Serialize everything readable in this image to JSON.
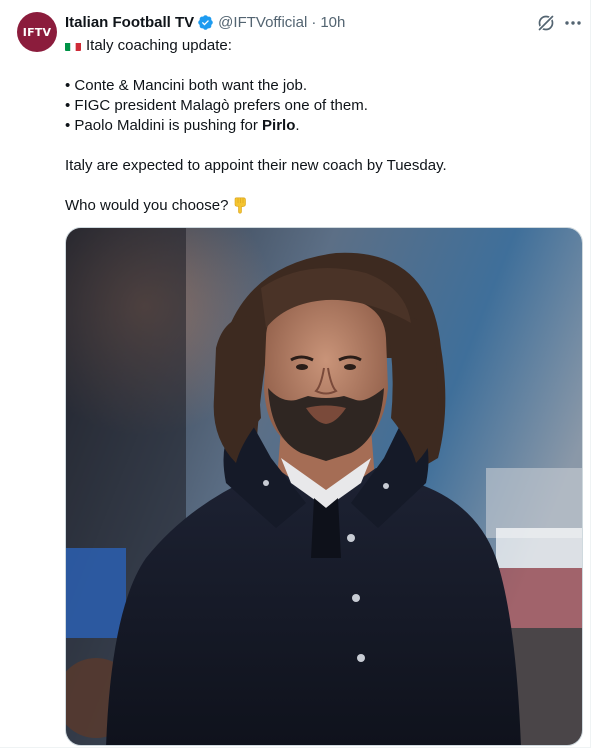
{
  "account": {
    "avatar_text": "IFTV",
    "display_name": "Italian Football TV",
    "handle": "@IFTVofficial",
    "separator": "·",
    "time": "10h"
  },
  "icons": {
    "avatar": "account-avatar",
    "verified": "verified-badge-icon",
    "grok": "grok-icon",
    "more": "more-options-icon",
    "flag": "italy-flag-emoji",
    "hand": "pointing-down-hand-emoji"
  },
  "colors": {
    "verified": "#1d9bf0",
    "avatar_bg": "#8b1c3c",
    "secondary_text": "#536471"
  },
  "tweet": {
    "headline": "Italy coaching update:",
    "bullets": [
      {
        "text": "• Conte & Mancini both want the job."
      },
      {
        "text": "• FIGC president Malagò prefers one of them."
      },
      {
        "prefix": "• Paolo Maldini is pushing for ",
        "bold": "Pirlo",
        "suffix": "."
      }
    ],
    "paragraph": "Italy are expected to appoint their new coach by Tuesday.",
    "question": "Who would you choose?"
  },
  "media": {
    "type": "photo",
    "subject": "man with shoulder-length hair and beard in dark coat"
  }
}
